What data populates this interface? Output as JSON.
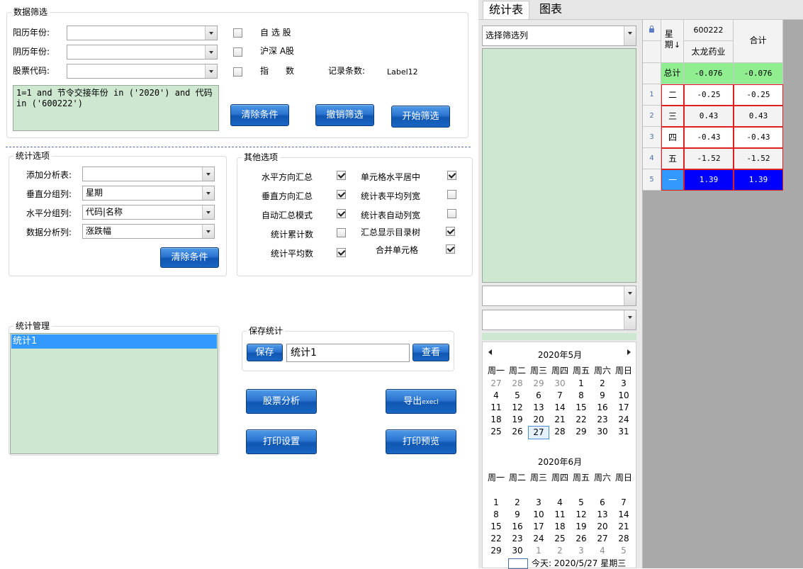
{
  "filter": {
    "title": "数据筛选",
    "solar_year_label": "阳历年份:",
    "lunar_year_label": "阴历年份:",
    "stock_code_label": "股票代码:",
    "solar_year_value": "",
    "lunar_year_value": "",
    "stock_code_value": "",
    "check_custom": "自 选 股",
    "check_hushen": "沪深 A股",
    "check_index": "指　　数",
    "record_count_label": "记录条数:",
    "record_count_value": "Label12",
    "condition_text": "1=1 and 节令交接年份 in ('2020') and 代码 in ('600222')",
    "clear_btn": "清除条件",
    "undo_btn": "撤销筛选",
    "start_btn": "开始筛选"
  },
  "stat_options": {
    "title": "统计选项",
    "add_table_label": "添加分析表:",
    "vgroup_label": "垂直分组列:",
    "hgroup_label": "水平分组列:",
    "data_col_label": "数据分析列:",
    "add_table_value": "",
    "vgroup_value": "星期",
    "hgroup_value": "代码|名称",
    "data_col_value": "涨跌幅",
    "clear_btn": "清除条件"
  },
  "other_options": {
    "title": "其他选项",
    "items": [
      {
        "label": "水平方向汇总",
        "checked": true
      },
      {
        "label": "垂直方向汇总",
        "checked": true
      },
      {
        "label": "自动汇总模式",
        "checked": true
      },
      {
        "label": "统计累计数",
        "checked": false
      },
      {
        "label": "统计平均数",
        "checked": true
      },
      {
        "label": "单元格水平居中",
        "checked": true
      },
      {
        "label": "统计表平均列宽",
        "checked": false
      },
      {
        "label": "统计表自动列宽",
        "checked": false
      },
      {
        "label": "汇总显示目录树",
        "checked": true
      },
      {
        "label": "合并单元格",
        "checked": true
      }
    ]
  },
  "manage": {
    "title": "统计管理",
    "items": [
      "统计1"
    ]
  },
  "save": {
    "title": "保存统计",
    "save_btn": "保存",
    "name_value": "统计1",
    "view_btn": "查看"
  },
  "actions": {
    "analysis_btn": "股票分析",
    "export_btn": "导出",
    "export_suffix": "execl",
    "print_setup_btn": "打印设置",
    "print_preview_btn": "打印预览"
  },
  "tabs": [
    "统计表",
    "图表"
  ],
  "mid": {
    "filter_col_placeholder": "选择筛选列",
    "combo2_value": "",
    "combo3_value": ""
  },
  "calendar": {
    "may_title": "2020年5月",
    "june_title": "2020年6月",
    "weekdays": [
      "周一",
      "周二",
      "周三",
      "周四",
      "周五",
      "周六",
      "周日"
    ],
    "may_rows": [
      [
        "27",
        "28",
        "29",
        "30",
        "1",
        "2",
        "3"
      ],
      [
        "4",
        "5",
        "6",
        "7",
        "8",
        "9",
        "10"
      ],
      [
        "11",
        "12",
        "13",
        "14",
        "15",
        "16",
        "17"
      ],
      [
        "18",
        "19",
        "20",
        "21",
        "22",
        "23",
        "24"
      ],
      [
        "25",
        "26",
        "27",
        "28",
        "29",
        "30",
        "31"
      ]
    ],
    "june_rows": [
      [
        "",
        "",
        "",
        "",
        "",
        "",
        ""
      ],
      [
        "1",
        "2",
        "3",
        "4",
        "5",
        "6",
        "7"
      ],
      [
        "8",
        "9",
        "10",
        "11",
        "12",
        "13",
        "14"
      ],
      [
        "15",
        "16",
        "17",
        "18",
        "19",
        "20",
        "21"
      ],
      [
        "22",
        "23",
        "24",
        "25",
        "26",
        "27",
        "28"
      ],
      [
        "29",
        "30",
        "1",
        "2",
        "3",
        "4",
        "5"
      ]
    ],
    "today_label": "今天: 2020/5/27 星期三"
  },
  "table": {
    "head_weekday": "星期",
    "head_sort": "↓",
    "head_code": "600222",
    "head_name": "太龙药业",
    "head_total": "合计",
    "rows": [
      {
        "idx": "",
        "day": "总计",
        "v": "-0.076",
        "t": "-0.076"
      },
      {
        "idx": "1",
        "day": "二",
        "v": "-0.25",
        "t": "-0.25"
      },
      {
        "idx": "2",
        "day": "三",
        "v": "0.43",
        "t": "0.43"
      },
      {
        "idx": "3",
        "day": "四",
        "v": "-0.43",
        "t": "-0.43"
      },
      {
        "idx": "4",
        "day": "五",
        "v": "-1.52",
        "t": "-1.52"
      },
      {
        "idx": "5",
        "day": "一",
        "v": "1.39",
        "t": "1.39"
      }
    ]
  },
  "colors": {
    "accent_blue": "#1a66c4",
    "panel_green": "#cde7d0",
    "total_green": "#90ee90",
    "selected_blue": "#0000ff",
    "negative_border": "#e02020"
  }
}
